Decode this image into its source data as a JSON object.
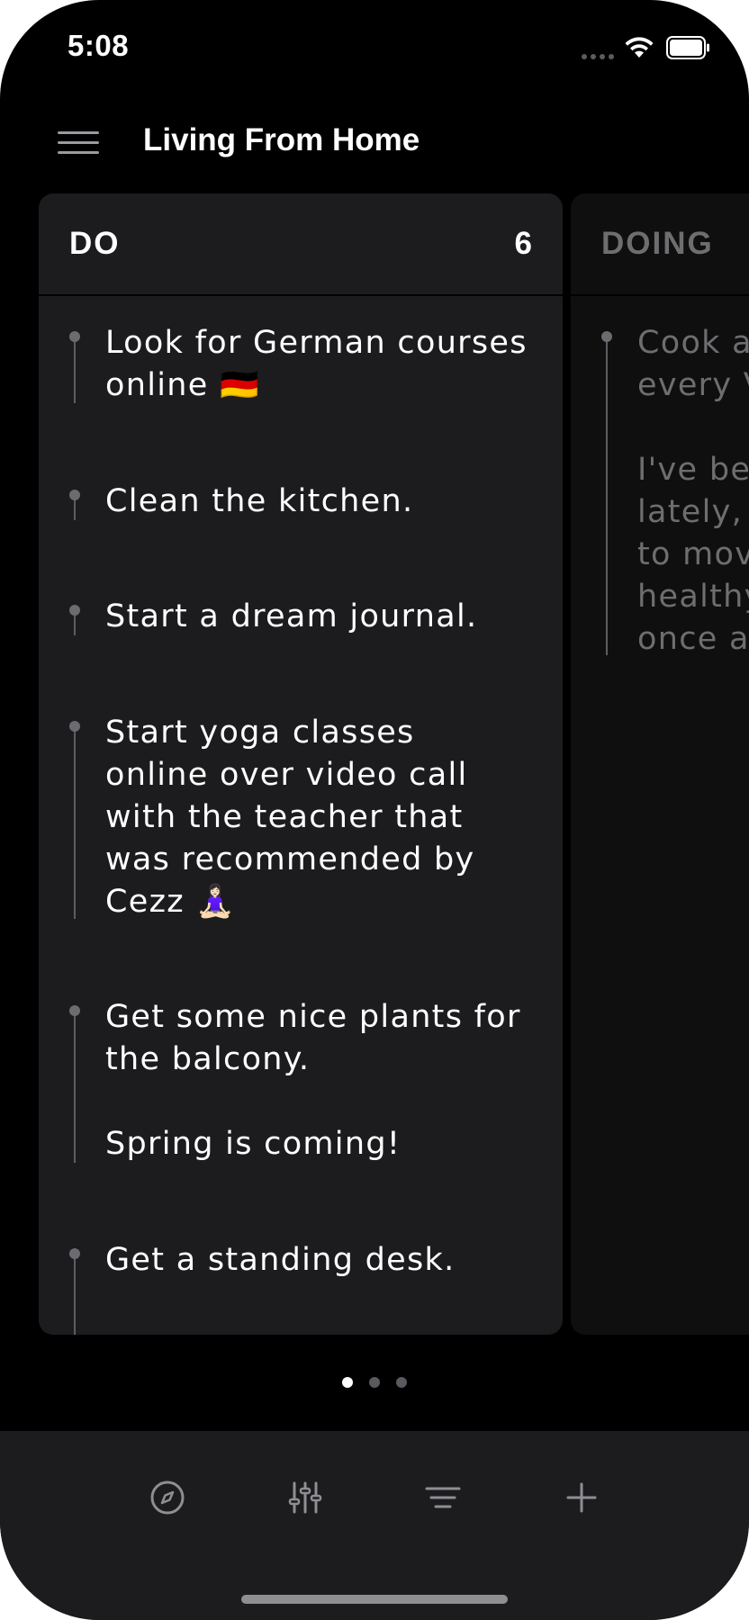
{
  "status_bar": {
    "time": "5:08",
    "signal_icon": "signal-dots-icon",
    "wifi_icon": "wifi-icon",
    "battery_icon": "battery-icon"
  },
  "nav": {
    "menu_icon": "hamburger-menu-icon",
    "title": "Living From Home"
  },
  "columns": [
    {
      "title": "DO",
      "count": "6",
      "cards": [
        "Look for German courses online 🇩🇪",
        "Clean the kitchen.",
        "Start a dream journal.",
        "Start yoga classes online over video call with the teacher that was recommended by Cezz 🧘🏻‍♀️",
        "Get some nice plants for the balcony.\n\nSpring is coming!",
        "Get a standing desk."
      ]
    },
    {
      "title": "DOING",
      "cards": [
        "Cook a\nevery V\n\nI've be\nlately, p\nto mov\nhealthy\nonce a"
      ]
    }
  ],
  "pagination": {
    "total": 3,
    "active": 1
  },
  "toolbar": {
    "items": [
      "compass-icon",
      "sliders-icon",
      "filter-icon",
      "plus-icon"
    ]
  },
  "colors": {
    "background": "#000000",
    "card_surface": "#1c1c1e",
    "text": "#ffffff",
    "muted_text": "#6e6e70",
    "toolbar": "#1c1c1e"
  }
}
